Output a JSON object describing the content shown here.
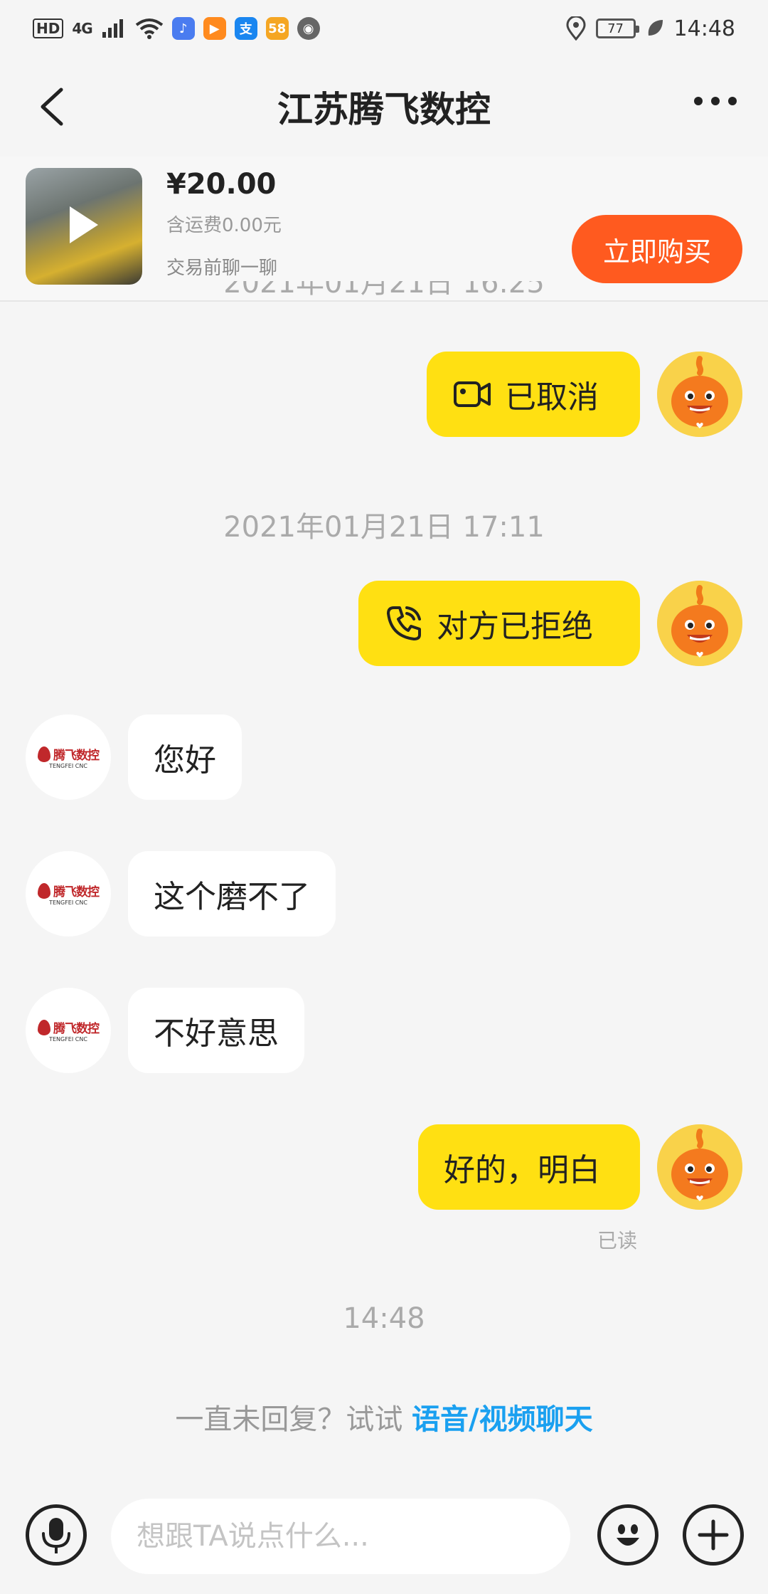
{
  "status_bar": {
    "hd": "HD",
    "network": "4G",
    "app_badge_58": "58",
    "battery": "77",
    "time": "14:48"
  },
  "header": {
    "title": "江苏腾飞数控"
  },
  "product": {
    "price": "¥20.00",
    "shipping": "含运费0.00元",
    "chat_hint": "交易前聊一聊",
    "buy_label": "立即购买"
  },
  "messages": {
    "partial_timestamp": "2021年01月21日 16:25",
    "video_call": "已取消",
    "timestamp_2": "2021年01月21日 17:11",
    "voice_call": "对方已拒绝",
    "msg_hello": "您好",
    "msg_cannot": "这个磨不了",
    "msg_sorry": "不好意思",
    "msg_ok": "好的，明白",
    "read_status": "已读",
    "timestamp_3": "14:48"
  },
  "hint": {
    "prefix": "一直未回复？试试 ",
    "link": "语音/视频聊天"
  },
  "seller_logo": {
    "name": "腾飞数控",
    "sub": "TENGFEI CNC"
  },
  "input": {
    "placeholder": "想跟TA说点什么..."
  },
  "colors": {
    "my_bubble": "#ffe012",
    "buy_button": "#ff5a1f",
    "link": "#1aa0f0"
  }
}
